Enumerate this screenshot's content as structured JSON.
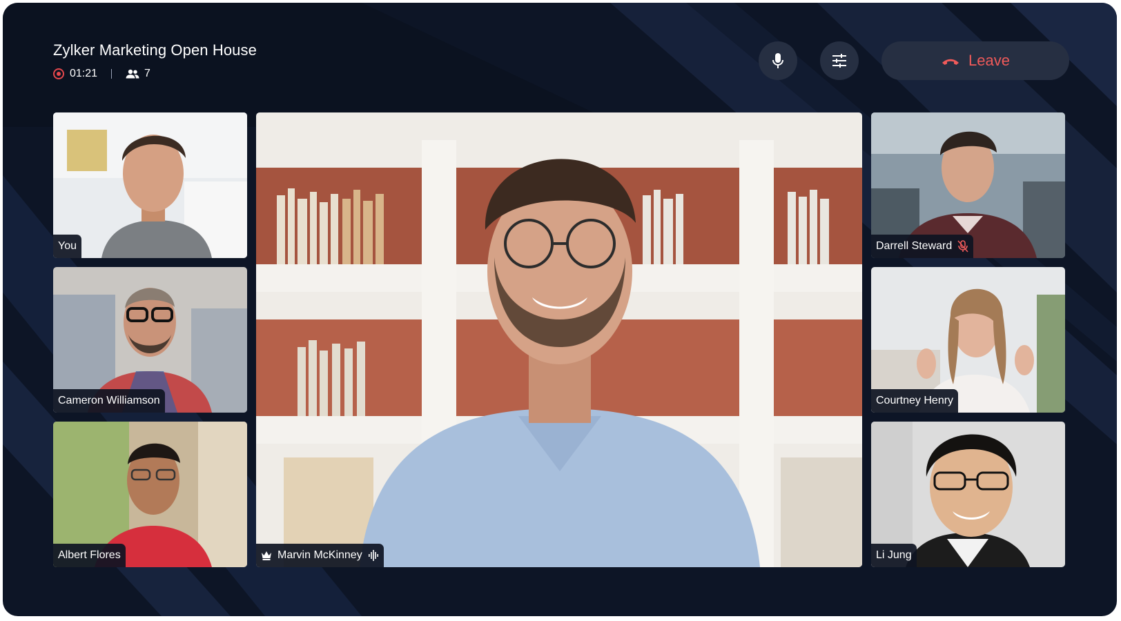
{
  "meeting": {
    "title": "Zylker Marketing Open House",
    "recording_time": "01:21",
    "participant_count": "7"
  },
  "controls": {
    "mic_icon": "microphone-icon",
    "settings_icon": "sliders-icon",
    "leave_label": "Leave",
    "leave_icon": "phone-hangup-icon"
  },
  "participants": [
    {
      "name": "You",
      "position": "left-top"
    },
    {
      "name": "Cameron Williamson",
      "position": "left-middle"
    },
    {
      "name": "Albert Flores",
      "position": "left-bottom"
    },
    {
      "name": "Marvin McKinney",
      "position": "main",
      "host": true,
      "speaking": true
    },
    {
      "name": "Darrell Steward",
      "position": "right-top",
      "muted": true
    },
    {
      "name": "Courtney Henry",
      "position": "right-middle"
    },
    {
      "name": "Li Jung",
      "position": "right-bottom"
    }
  ],
  "colors": {
    "background": "#0d1526",
    "control_bg": "#262f42",
    "leave_text": "#ef5a5a",
    "record_dot": "#e5484d",
    "name_tag_bg": "#0e1422"
  }
}
